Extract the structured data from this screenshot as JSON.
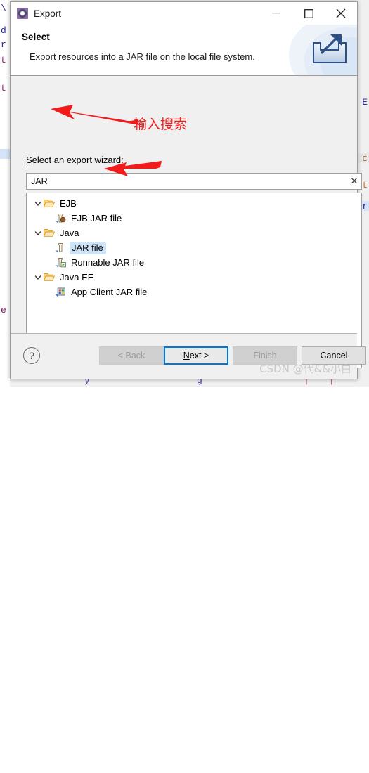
{
  "window": {
    "title": "Export",
    "icon": "eclipse-export-icon",
    "controls": {
      "minimize": "minimize-icon",
      "maximize": "maximize-icon",
      "close": "close-icon"
    }
  },
  "header": {
    "title": "Select",
    "description": "Export resources into a JAR file on the local file system.",
    "banner_icon": "export-arrow-icon"
  },
  "form": {
    "wizard_label": "Select an export wizard:",
    "wizard_label_mnemonic": "S",
    "search": {
      "value": "JAR",
      "placeholder": "",
      "clear_icon": "clear-x-icon"
    }
  },
  "tree": {
    "items": [
      {
        "label": "EJB",
        "depth": 0,
        "icon": "open-folder-icon",
        "twisty": "chevron-down-icon",
        "selected": false
      },
      {
        "label": "EJB JAR file",
        "depth": 1,
        "icon": "ejb-jar-file-icon",
        "twisty": "",
        "selected": false
      },
      {
        "label": "Java",
        "depth": 0,
        "icon": "open-folder-icon",
        "twisty": "chevron-down-icon",
        "selected": false
      },
      {
        "label": "JAR file",
        "depth": 1,
        "icon": "jar-file-icon",
        "twisty": "",
        "selected": true
      },
      {
        "label": "Runnable JAR file",
        "depth": 1,
        "icon": "runnable-jar-icon",
        "twisty": "",
        "selected": false
      },
      {
        "label": "Java EE",
        "depth": 0,
        "icon": "open-folder-icon",
        "twisty": "chevron-down-icon",
        "selected": false
      },
      {
        "label": "App Client JAR file",
        "depth": 1,
        "icon": "app-client-jar-icon",
        "twisty": "",
        "selected": false
      }
    ]
  },
  "footer": {
    "help_label": "?",
    "buttons": {
      "back": {
        "label": "< Back",
        "state": "disabled"
      },
      "next": {
        "label": "Next >",
        "state": "default"
      },
      "finish": {
        "label": "Finish",
        "state": "disabled"
      },
      "cancel": {
        "label": "Cancel",
        "state": "enabled"
      }
    }
  },
  "annotations": {
    "search_note": "输入搜索",
    "arrow_color": "#f21b1b"
  },
  "watermark": {
    "text": "CSDN @代&&小白"
  },
  "background": {
    "left_fragments": [
      "\\",
      "d",
      "r",
      "t",
      "e"
    ],
    "right_fragments": [
      "E",
      "c",
      "t",
      "r"
    ]
  }
}
